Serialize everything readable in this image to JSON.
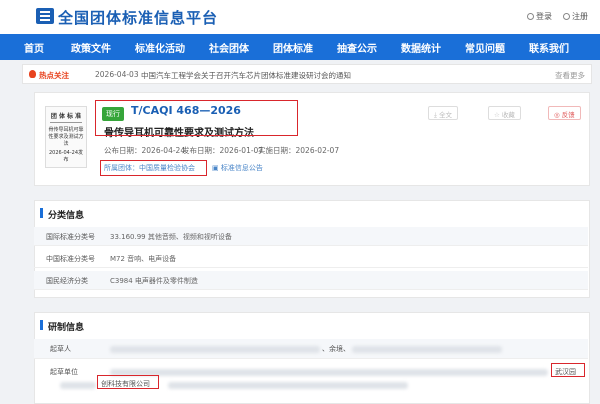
{
  "header": {
    "site_title": "全国团体标准信息平台",
    "login": "登录",
    "register": "注册"
  },
  "nav": [
    "首页",
    "政策文件",
    "标准化活动",
    "社会团体",
    "团体标准",
    "抽查公示",
    "数据统计",
    "常见问题",
    "联系我们"
  ],
  "notice": {
    "label": "热点关注",
    "date": "2026-04-03",
    "text": "中国汽车工程学会关于召开汽车芯片团体标准建设研讨会的通知",
    "more": "查看更多"
  },
  "standard": {
    "status": "现行",
    "code": "T/CAQI 468—2026",
    "name": "骨传导耳机可靠性要求及测试方法",
    "publish_date_label": "公布日期：",
    "publish_date": "2026-04-24",
    "release_date_label": "发布日期：",
    "release_date": "2026-01-07",
    "implement_date_label": "实施日期：",
    "implement_date": "2026-02-07",
    "org": "所属团体：中国质量检验协会",
    "org_button": "标准信息公告",
    "cover": {
      "head": "团 体 标 准",
      "body": "骨传导耳机可靠性要求及测试方法",
      "date": "2026-04-24发布"
    },
    "actions": {
      "download": "全文",
      "favorite": "收藏",
      "feedback": "反馈"
    }
  },
  "classification": {
    "title": "分类信息",
    "rows": [
      {
        "key": "国际标准分类号",
        "value": "33.160.99 其他音频、视频和视听设备"
      },
      {
        "key": "中国标准分类号",
        "value": "M72 音响、电声设备"
      },
      {
        "key": "国民经济分类",
        "value": "C3984 电声器件及零件制造"
      }
    ]
  },
  "drafting": {
    "title": "研制信息",
    "drafters_label": "起草人",
    "drafters_tail": "、余境、",
    "units_label": "起草单位",
    "unit_right": "武汉园",
    "unit_second": "创科技有限公司"
  },
  "colors": {
    "brand": "#1a5fb4",
    "nav": "#1a6fd8",
    "status": "#36a53a",
    "highlight": "#d9262c"
  }
}
